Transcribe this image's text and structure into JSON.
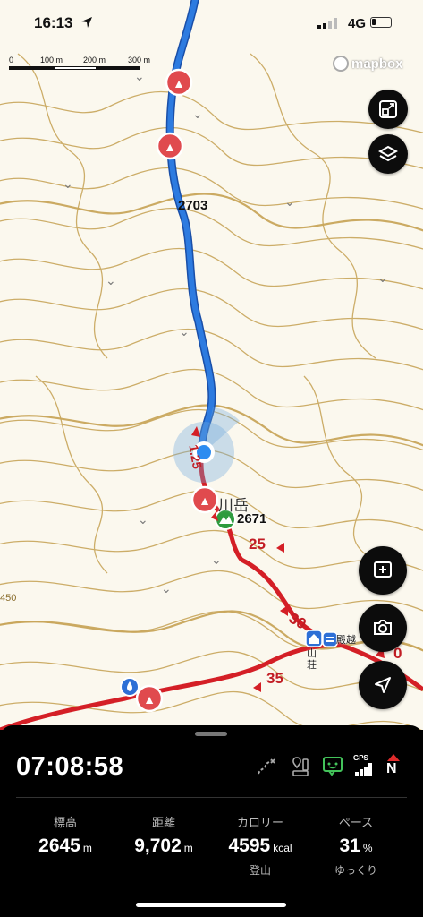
{
  "status_bar": {
    "time": "16:13",
    "network": "4G"
  },
  "scale": {
    "labels": [
      "0",
      "100 m",
      "200 m",
      "300 m"
    ]
  },
  "map": {
    "attribution": "mapbox",
    "contour_label": "2703",
    "peak_name": "川岳",
    "peak_elevation": "2671",
    "trail_markers": [
      "1.25",
      "25",
      "30",
      "35",
      "0"
    ],
    "hut_name_a": "殿越",
    "hut_name_b": "山荘",
    "edge_label": "450",
    "colors": {
      "contour": "#c8a55a",
      "route_blue": "#2d7be0",
      "trail_red": "#d41f26",
      "warning_red": "#e04a4e",
      "peak_green": "#2e9b3e"
    }
  },
  "buttons": {
    "expand": "expand-icon",
    "layers": "layers-icon",
    "add_note": "add-note-icon",
    "camera": "camera-icon",
    "locate": "navigation-arrow-icon"
  },
  "panel": {
    "elapsed": "07:08:58",
    "stats": [
      {
        "label": "標高",
        "value": "2645",
        "unit": "m",
        "sub": ""
      },
      {
        "label": "距離",
        "value": "9,702",
        "unit": "m",
        "sub": ""
      },
      {
        "label": "カロリー",
        "value": "4595",
        "unit": "kcal",
        "sub": "登山"
      },
      {
        "label": "ペース",
        "value": "31",
        "unit": "%",
        "sub": "ゆっくり"
      }
    ],
    "status_icons": [
      "route-off-icon",
      "pin-gauge-icon",
      "chat-icon",
      "gps-icon",
      "compass-north-icon"
    ],
    "gps_label": "GPS",
    "compass_label": "N"
  }
}
